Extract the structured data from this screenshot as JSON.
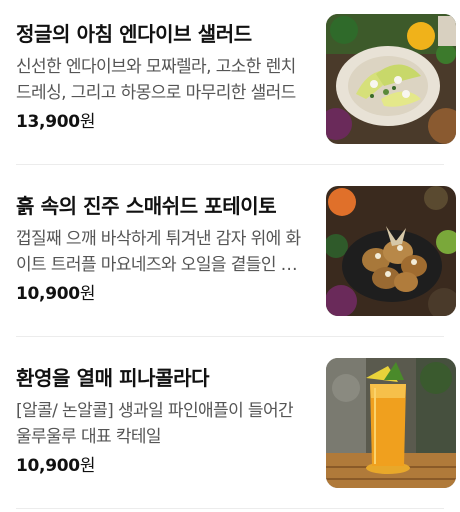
{
  "menu": {
    "items": [
      {
        "name": "정글의 아침 엔다이브 샐러드",
        "description": "신선한 엔다이브와 모짜렐라, 고소한 렌치 드레싱, 그리고 하몽으로 마무리한 샐러드",
        "price": "13,900",
        "currency": "원",
        "image": "endive-salad-photo"
      },
      {
        "name": "흙 속의 진주 스매쉬드 포테이토",
        "description": "껍질째 으깨 바삭하게 튀겨낸 감자 위에 화이트 트러플 마요네즈와 오일을 곁들인 메뉴",
        "price": "10,900",
        "currency": "원",
        "image": "smashed-potato-photo"
      },
      {
        "name": "환영을 열매 피나콜라다",
        "description": "[알콜/ 논알콜] 생과일 파인애플이 들어간 울루울루 대표 칵테일",
        "price": "10,900",
        "currency": "원",
        "image": "pina-colada-photo"
      }
    ]
  }
}
